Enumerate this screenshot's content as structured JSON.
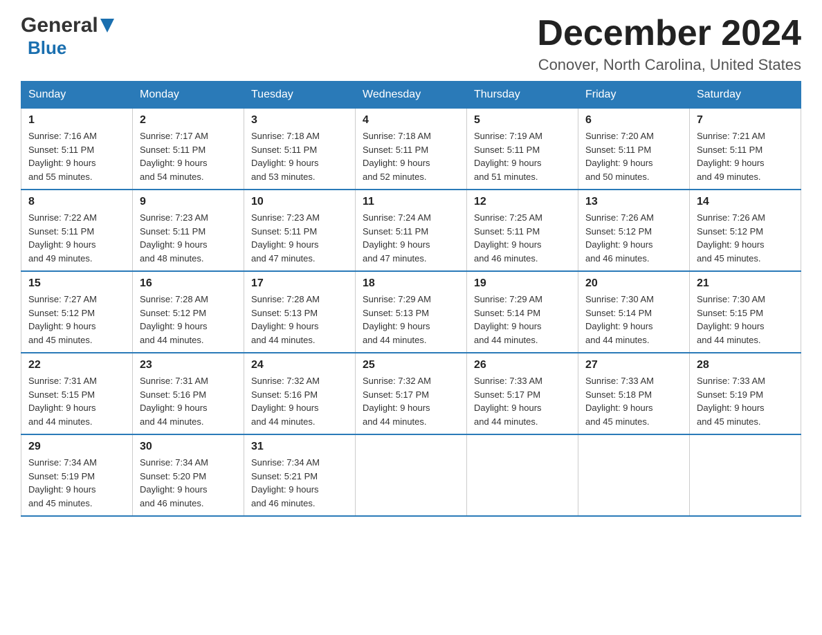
{
  "logo": {
    "general": "General",
    "blue": "Blue"
  },
  "title": {
    "month_year": "December 2024",
    "location": "Conover, North Carolina, United States"
  },
  "days_of_week": [
    "Sunday",
    "Monday",
    "Tuesday",
    "Wednesday",
    "Thursday",
    "Friday",
    "Saturday"
  ],
  "weeks": [
    [
      {
        "day": "1",
        "sunrise": "7:16 AM",
        "sunset": "5:11 PM",
        "daylight": "9 hours and 55 minutes."
      },
      {
        "day": "2",
        "sunrise": "7:17 AM",
        "sunset": "5:11 PM",
        "daylight": "9 hours and 54 minutes."
      },
      {
        "day": "3",
        "sunrise": "7:18 AM",
        "sunset": "5:11 PM",
        "daylight": "9 hours and 53 minutes."
      },
      {
        "day": "4",
        "sunrise": "7:18 AM",
        "sunset": "5:11 PM",
        "daylight": "9 hours and 52 minutes."
      },
      {
        "day": "5",
        "sunrise": "7:19 AM",
        "sunset": "5:11 PM",
        "daylight": "9 hours and 51 minutes."
      },
      {
        "day": "6",
        "sunrise": "7:20 AM",
        "sunset": "5:11 PM",
        "daylight": "9 hours and 50 minutes."
      },
      {
        "day": "7",
        "sunrise": "7:21 AM",
        "sunset": "5:11 PM",
        "daylight": "9 hours and 49 minutes."
      }
    ],
    [
      {
        "day": "8",
        "sunrise": "7:22 AM",
        "sunset": "5:11 PM",
        "daylight": "9 hours and 49 minutes."
      },
      {
        "day": "9",
        "sunrise": "7:23 AM",
        "sunset": "5:11 PM",
        "daylight": "9 hours and 48 minutes."
      },
      {
        "day": "10",
        "sunrise": "7:23 AM",
        "sunset": "5:11 PM",
        "daylight": "9 hours and 47 minutes."
      },
      {
        "day": "11",
        "sunrise": "7:24 AM",
        "sunset": "5:11 PM",
        "daylight": "9 hours and 47 minutes."
      },
      {
        "day": "12",
        "sunrise": "7:25 AM",
        "sunset": "5:11 PM",
        "daylight": "9 hours and 46 minutes."
      },
      {
        "day": "13",
        "sunrise": "7:26 AM",
        "sunset": "5:12 PM",
        "daylight": "9 hours and 46 minutes."
      },
      {
        "day": "14",
        "sunrise": "7:26 AM",
        "sunset": "5:12 PM",
        "daylight": "9 hours and 45 minutes."
      }
    ],
    [
      {
        "day": "15",
        "sunrise": "7:27 AM",
        "sunset": "5:12 PM",
        "daylight": "9 hours and 45 minutes."
      },
      {
        "day": "16",
        "sunrise": "7:28 AM",
        "sunset": "5:12 PM",
        "daylight": "9 hours and 44 minutes."
      },
      {
        "day": "17",
        "sunrise": "7:28 AM",
        "sunset": "5:13 PM",
        "daylight": "9 hours and 44 minutes."
      },
      {
        "day": "18",
        "sunrise": "7:29 AM",
        "sunset": "5:13 PM",
        "daylight": "9 hours and 44 minutes."
      },
      {
        "day": "19",
        "sunrise": "7:29 AM",
        "sunset": "5:14 PM",
        "daylight": "9 hours and 44 minutes."
      },
      {
        "day": "20",
        "sunrise": "7:30 AM",
        "sunset": "5:14 PM",
        "daylight": "9 hours and 44 minutes."
      },
      {
        "day": "21",
        "sunrise": "7:30 AM",
        "sunset": "5:15 PM",
        "daylight": "9 hours and 44 minutes."
      }
    ],
    [
      {
        "day": "22",
        "sunrise": "7:31 AM",
        "sunset": "5:15 PM",
        "daylight": "9 hours and 44 minutes."
      },
      {
        "day": "23",
        "sunrise": "7:31 AM",
        "sunset": "5:16 PM",
        "daylight": "9 hours and 44 minutes."
      },
      {
        "day": "24",
        "sunrise": "7:32 AM",
        "sunset": "5:16 PM",
        "daylight": "9 hours and 44 minutes."
      },
      {
        "day": "25",
        "sunrise": "7:32 AM",
        "sunset": "5:17 PM",
        "daylight": "9 hours and 44 minutes."
      },
      {
        "day": "26",
        "sunrise": "7:33 AM",
        "sunset": "5:17 PM",
        "daylight": "9 hours and 44 minutes."
      },
      {
        "day": "27",
        "sunrise": "7:33 AM",
        "sunset": "5:18 PM",
        "daylight": "9 hours and 45 minutes."
      },
      {
        "day": "28",
        "sunrise": "7:33 AM",
        "sunset": "5:19 PM",
        "daylight": "9 hours and 45 minutes."
      }
    ],
    [
      {
        "day": "29",
        "sunrise": "7:34 AM",
        "sunset": "5:19 PM",
        "daylight": "9 hours and 45 minutes."
      },
      {
        "day": "30",
        "sunrise": "7:34 AM",
        "sunset": "5:20 PM",
        "daylight": "9 hours and 46 minutes."
      },
      {
        "day": "31",
        "sunrise": "7:34 AM",
        "sunset": "5:21 PM",
        "daylight": "9 hours and 46 minutes."
      },
      null,
      null,
      null,
      null
    ]
  ],
  "labels": {
    "sunrise": "Sunrise:",
    "sunset": "Sunset:",
    "daylight": "Daylight:"
  },
  "colors": {
    "header_bg": "#2a7ab8",
    "header_text": "#ffffff",
    "border": "#ccc",
    "accent": "#1a6faf"
  }
}
